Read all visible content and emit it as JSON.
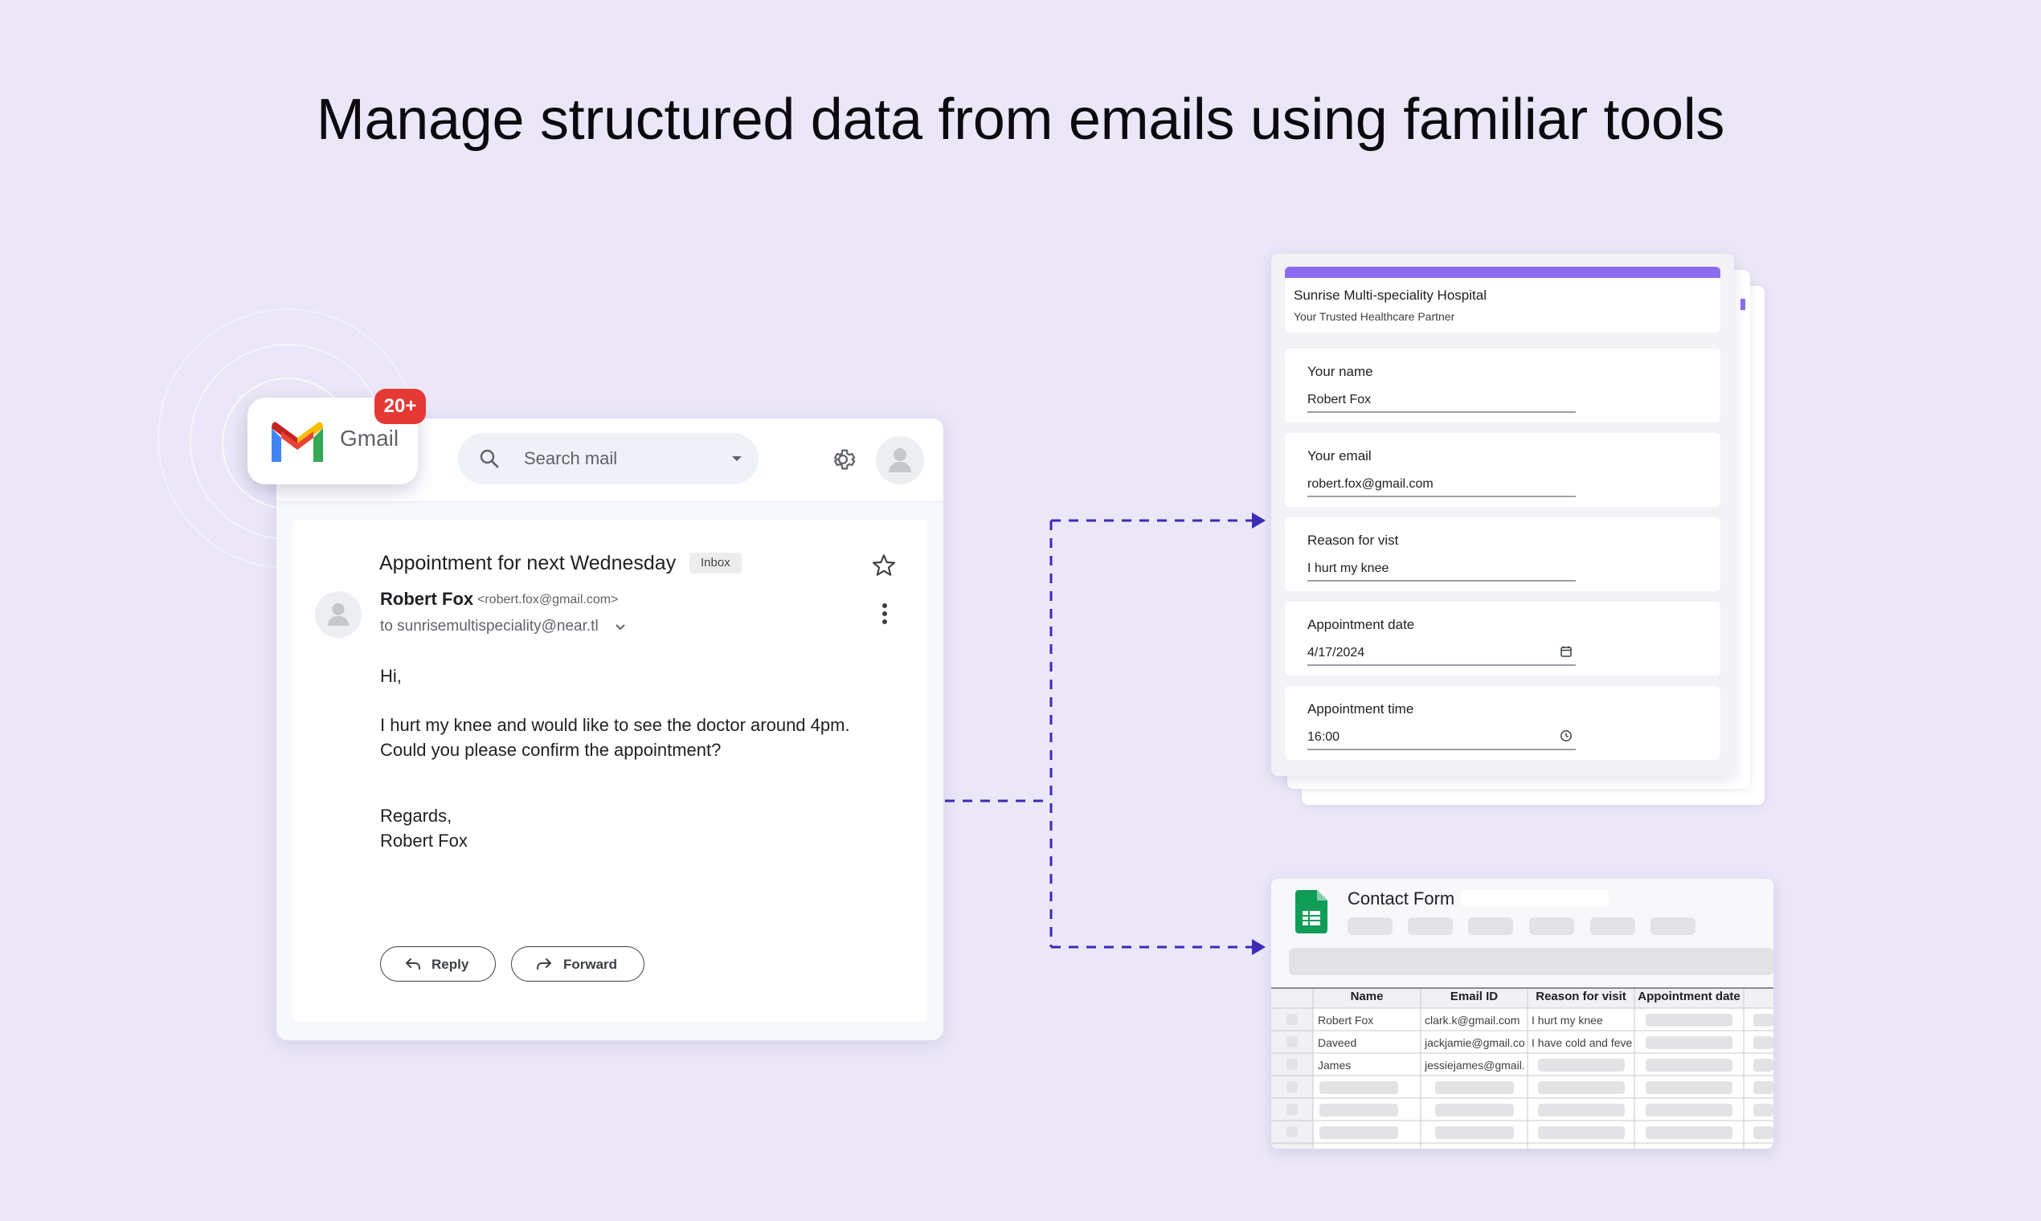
{
  "headline": "Manage structured data from emails using familiar tools",
  "colors": {
    "background": "#ebe7f8",
    "accent_purple": "#8b6cf0",
    "connector": "#3b2bb5",
    "badge_red": "#e53935",
    "sheets_green": "#0f9d58"
  },
  "gmail": {
    "app_name": "Gmail",
    "badge": "20+",
    "search_placeholder": "Search mail",
    "email": {
      "subject": "Appointment for next Wednesday",
      "label": "Inbox",
      "sender_name": "Robert Fox",
      "sender_email": "<robert.fox@gmail.com>",
      "to": "to sunrisemultispeciality@near.tl",
      "body": [
        "Hi,",
        "I hurt my knee and would like to see the doctor around 4pm.",
        "Could you please confirm the appointment?",
        "Regards,",
        "Robert Fox"
      ]
    },
    "reply_label": "Reply",
    "forward_label": "Forward",
    "icons": [
      "gmail-logo-icon",
      "search-icon",
      "dropdown-caret-icon",
      "gear-icon",
      "account-icon",
      "star-icon",
      "more-vert-icon",
      "reply-icon",
      "forward-icon"
    ]
  },
  "form": {
    "title": "Sunrise Multi-speciality Hospital",
    "subtitle": "Your Trusted Healthcare Partner",
    "fields": [
      {
        "label": "Your name",
        "value": "Robert Fox"
      },
      {
        "label": "Your email",
        "value": "robert.fox@gmail.com"
      },
      {
        "label": "Reason for vist",
        "value": "I hurt my knee"
      },
      {
        "label": "Appointment date",
        "value": "4/17/2024"
      },
      {
        "label": "Appointment time",
        "value": "16:00"
      }
    ]
  },
  "sheet": {
    "title": "Contact Form",
    "headers": [
      "Name",
      "Email ID",
      "Reason for visit",
      "Appointment date"
    ],
    "rows": [
      [
        "Robert Fox",
        "clark.k@gmail.com",
        "I hurt my knee"
      ],
      [
        "Daveed",
        "jackjamie@gmail.com",
        "I have cold and fever"
      ],
      [
        "James",
        "jessiejames@gmail.com",
        ""
      ]
    ]
  }
}
